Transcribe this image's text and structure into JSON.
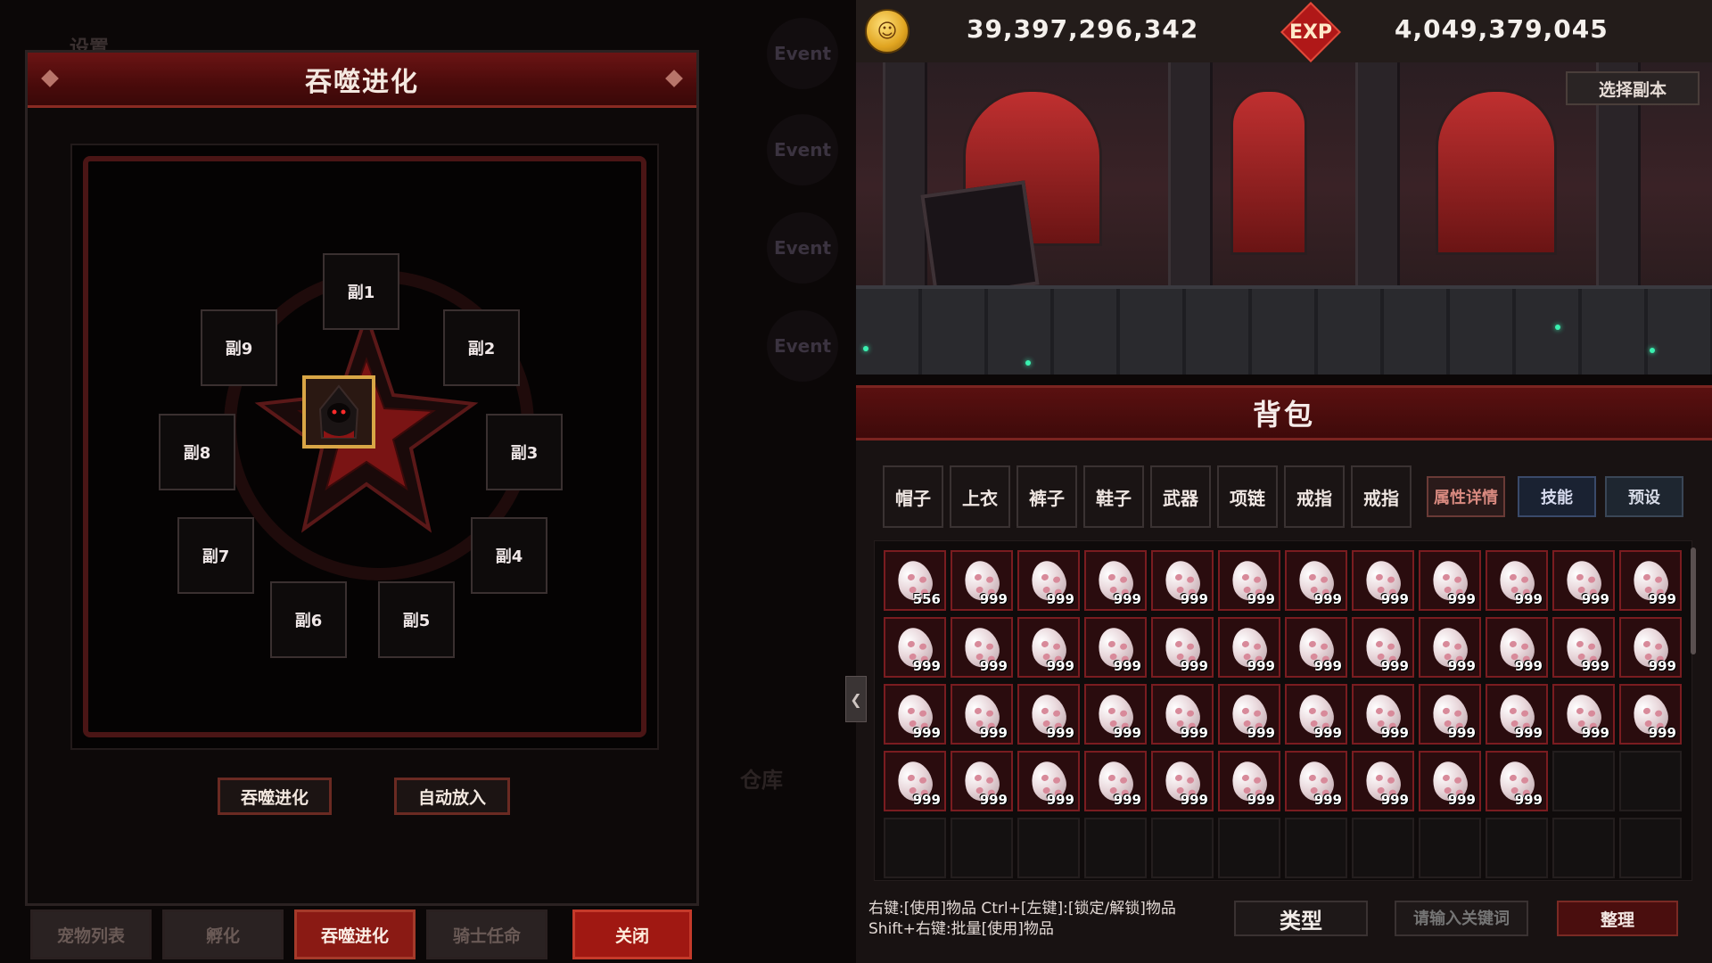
{
  "background": {
    "settings_label": "设置",
    "event_labels": [
      "Event",
      "Event",
      "Event",
      "Event"
    ],
    "warehouse_label": "仓库"
  },
  "evolution": {
    "title": "吞噬进化",
    "slots": [
      "副1",
      "副2",
      "副3",
      "副4",
      "副5",
      "副6",
      "副7",
      "副8",
      "副9"
    ],
    "devour_button": "吞噬进化",
    "auto_button": "自动放入"
  },
  "bottom_tabs": [
    "宠物列表",
    "孵化",
    "吞噬进化",
    "骑士任命",
    "关闭"
  ],
  "resources": {
    "gold": "39,397,296,342",
    "exp_label": "EXP",
    "exp": "4,049,379,045"
  },
  "scene": {
    "select_dungeon": "选择副本"
  },
  "bag": {
    "title": "背包",
    "equip_tabs": [
      "帽子",
      "上衣",
      "裤子",
      "鞋子",
      "武器",
      "项链",
      "戒指",
      "戒指"
    ],
    "func_tabs": [
      "属性详情",
      "技能",
      "预设"
    ],
    "items": [
      "556",
      "999",
      "999",
      "999",
      "999",
      "999",
      "999",
      "999",
      "999",
      "999",
      "999",
      "999",
      "999",
      "999",
      "999",
      "999",
      "999",
      "999",
      "999",
      "999",
      "999",
      "999",
      "999",
      "999",
      "999",
      "999",
      "999",
      "999",
      "999",
      "999",
      "999",
      "999",
      "999",
      "999",
      "999",
      "999",
      "999",
      "999",
      "999",
      "999",
      "999",
      "999",
      "999",
      "999",
      "999",
      "999"
    ],
    "total_slots": 60,
    "hint_line1": "右键:[使用]物品 Ctrl+[左键]:[锁定/解锁]物品",
    "hint_line2": "Shift+右键:批量[使用]物品",
    "type_button": "类型",
    "search_placeholder": "请输入关键词",
    "sort_button": "整理"
  },
  "colors": {
    "accent_red": "#8a1a14",
    "gold": "#e0a420",
    "item_border": "#7a1c20"
  }
}
